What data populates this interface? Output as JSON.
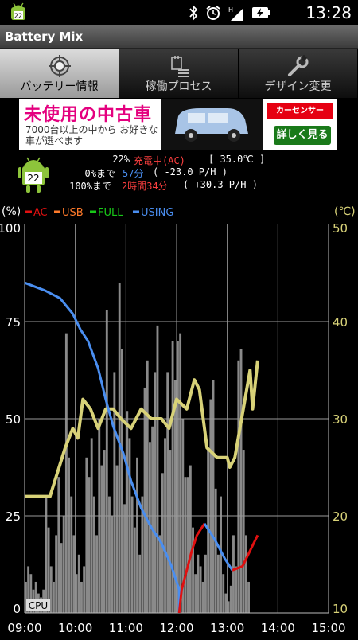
{
  "status_bar": {
    "time": "13:28",
    "battery_badge": "22",
    "network": "H",
    "icons": [
      "android-battery-icon",
      "bluetooth-icon",
      "alarm-icon",
      "signal-icon",
      "battery-charging-icon"
    ]
  },
  "app": {
    "title": "Battery Mix"
  },
  "tabs": [
    {
      "label": "バッテリー情報",
      "icon": "target-icon",
      "active": true
    },
    {
      "label": "稼働プロセス",
      "icon": "process-list-icon",
      "active": false
    },
    {
      "label": "デザイン変更",
      "icon": "wrench-icon",
      "active": false
    }
  ],
  "ad": {
    "headline": "未使用の中古車",
    "sub": "7000台以上の中から お好きな車が選べます",
    "logo": "カーセンサー carsensor",
    "cta": "詳しく見る"
  },
  "battery_info": {
    "badge": "22",
    "percent": "22%",
    "status": "充電中(AC)",
    "temp": "[ 35.0℃ ]",
    "empty_label": "0%まで",
    "empty_time": "57分",
    "empty_rate": "( -23.0 P/H )",
    "full_label": "100%まで",
    "full_time": "2時間34分",
    "full_rate": "( +30.3 P/H )"
  },
  "chart_data": {
    "type": "line",
    "units_left": "(%)",
    "units_right": "(℃)",
    "legend": [
      {
        "name": "AC",
        "color": "#e01010"
      },
      {
        "name": "USB",
        "color": "#ff7a2a"
      },
      {
        "name": "FULL",
        "color": "#18c818"
      },
      {
        "name": "USING",
        "color": "#4a8ef0"
      }
    ],
    "y_left_ticks": [
      "100",
      "75",
      "50",
      "25",
      "0"
    ],
    "y_right_ticks": [
      "50",
      "40",
      "30",
      "20",
      "10"
    ],
    "x_ticks": [
      "09:00",
      "10:00",
      "11:00",
      "12:00",
      "13:00",
      "14:00",
      "15:00"
    ],
    "cpu_label": "CPU",
    "ylim_left": [
      0,
      100
    ],
    "ylim_right": [
      10,
      50
    ],
    "x_range": [
      9,
      15
    ],
    "series": [
      {
        "name": "USING",
        "color": "#4a8ef0",
        "x": [
          9.0,
          9.4,
          9.7,
          9.95,
          10.1,
          10.25,
          10.45,
          10.6,
          10.75,
          10.95,
          11.1,
          11.3,
          11.5,
          11.7,
          11.9,
          12.05,
          12.05
        ],
        "y": [
          85,
          83,
          81,
          77,
          73,
          70,
          63,
          55,
          48,
          41,
          34,
          27,
          22,
          18,
          12,
          6,
          0
        ]
      },
      {
        "name": "AC",
        "color": "#e01010",
        "x": [
          12.05,
          12.1,
          12.2,
          12.3,
          12.4,
          12.55
        ],
        "y": [
          0,
          6,
          11,
          16,
          20,
          23
        ]
      },
      {
        "name": "USING2",
        "color": "#4a8ef0",
        "x": [
          12.55,
          12.75,
          12.95,
          13.1
        ],
        "y": [
          23,
          19,
          14,
          11
        ]
      },
      {
        "name": "AC2",
        "color": "#e01010",
        "x": [
          13.1,
          13.3,
          13.45,
          13.6
        ],
        "y": [
          11,
          12,
          16,
          20
        ]
      }
    ],
    "temperature": {
      "color": "#d8d278",
      "x": [
        9.0,
        9.5,
        9.8,
        9.95,
        10.05,
        10.15,
        10.3,
        10.45,
        10.6,
        10.75,
        10.9,
        11.1,
        11.3,
        11.5,
        11.7,
        11.85,
        12.0,
        12.2,
        12.35,
        12.45,
        12.6,
        12.8,
        13.0,
        13.05,
        13.15,
        13.25,
        13.35,
        13.45,
        13.5,
        13.6
      ],
      "y": [
        22,
        22,
        27,
        29,
        28,
        32,
        31,
        29,
        31,
        31,
        30,
        29,
        31,
        30,
        30,
        29,
        32,
        31,
        34,
        33,
        27,
        26,
        26,
        25,
        26,
        29,
        32,
        35,
        31,
        36
      ]
    },
    "cpu": {
      "color": "#8a8a8a",
      "x": [
        9.0,
        9.05,
        9.1,
        9.15,
        9.2,
        9.25,
        9.3,
        9.35,
        9.4,
        9.45,
        9.5,
        9.55,
        9.6,
        9.65,
        9.7,
        9.75,
        9.8,
        9.85,
        9.9,
        9.95,
        10.0,
        10.05,
        10.1,
        10.15,
        10.2,
        10.25,
        10.3,
        10.35,
        10.4,
        10.45,
        10.5,
        10.55,
        10.6,
        10.65,
        10.7,
        10.75,
        10.8,
        10.85,
        10.9,
        10.95,
        11.0,
        11.05,
        11.1,
        11.15,
        11.2,
        11.25,
        11.3,
        11.35,
        11.4,
        11.45,
        11.5,
        11.55,
        11.6,
        11.65,
        11.7,
        11.75,
        11.8,
        11.85,
        11.9,
        11.95,
        12.0,
        12.05,
        12.1,
        12.15,
        12.2,
        12.25,
        12.3,
        12.35,
        12.4,
        12.45,
        12.5,
        12.55,
        12.6,
        12.65,
        12.7,
        12.75,
        12.8,
        12.85,
        12.9,
        12.95,
        13.0,
        13.05,
        13.1,
        13.15,
        13.2,
        13.25,
        13.3,
        13.35,
        13.4
      ],
      "y": [
        8,
        12,
        10,
        6,
        8,
        5,
        4,
        6,
        30,
        22,
        12,
        8,
        20,
        35,
        18,
        25,
        72,
        40,
        30,
        20,
        10,
        15,
        8,
        12,
        40,
        35,
        45,
        30,
        20,
        50,
        38,
        42,
        78,
        30,
        25,
        62,
        38,
        85,
        68,
        28,
        52,
        45,
        30,
        22,
        40,
        15,
        30,
        58,
        65,
        44,
        48,
        62,
        74,
        20,
        36,
        45,
        62,
        42,
        70,
        60,
        70,
        72,
        50,
        35,
        35,
        38,
        22,
        10,
        15,
        12,
        8,
        15,
        42,
        55,
        60,
        32,
        15,
        30,
        10,
        5,
        3,
        7,
        20,
        12,
        65,
        68,
        42,
        20,
        8
      ]
    }
  }
}
